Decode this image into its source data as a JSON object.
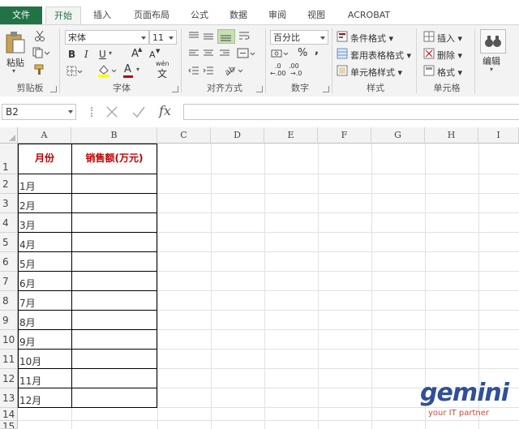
{
  "tabs": {
    "file": "文件",
    "items": [
      "开始",
      "插入",
      "页面布局",
      "公式",
      "数据",
      "审阅",
      "视图",
      "ACROBAT"
    ]
  },
  "ribbon": {
    "clipboard": {
      "paste": "粘贴",
      "label": "剪贴板"
    },
    "font": {
      "name": "宋体",
      "size": "11",
      "bold": "B",
      "italic": "I",
      "underline": "U",
      "grow": "A",
      "shrink": "A",
      "font_color_glyph": "A",
      "phonetic": "wén",
      "label": "字体"
    },
    "alignment": {
      "label": "对齐方式"
    },
    "number": {
      "format": "百分比",
      "percent": "%",
      "comma": ",",
      "inc": ".00",
      "dec": ".0",
      "label": "数字"
    },
    "styles": {
      "conditional": "条件格式",
      "table": "套用表格格式",
      "cell": "单元格样式",
      "label": "样式"
    },
    "cells": {
      "insert": "插入",
      "delete": "删除",
      "format": "格式",
      "label": "单元格"
    },
    "editing": {
      "label": "编辑"
    }
  },
  "formula_bar": {
    "name_box": "B2",
    "fx": "fx",
    "value": ""
  },
  "sheet": {
    "columns": [
      "A",
      "B",
      "C",
      "D",
      "E",
      "F",
      "G",
      "H",
      "I"
    ],
    "rows": [
      "1",
      "2",
      "3",
      "4",
      "5",
      "6",
      "7",
      "8",
      "9",
      "10",
      "11",
      "12",
      "13",
      "14",
      "15"
    ],
    "header": {
      "a": "月份",
      "b": "销售额(万元)"
    },
    "months": [
      "1月",
      "2月",
      "3月",
      "4月",
      "5月",
      "6月",
      "7月",
      "8月",
      "9月",
      "10月",
      "11月",
      "12月"
    ]
  },
  "watermark": {
    "brand": "gemini",
    "tagline": "your IT partner"
  },
  "colors": {
    "accent": "#217346",
    "header_text": "#c00000",
    "watermark_blue": "#2f4f9a",
    "watermark_red": "#d0493a"
  }
}
